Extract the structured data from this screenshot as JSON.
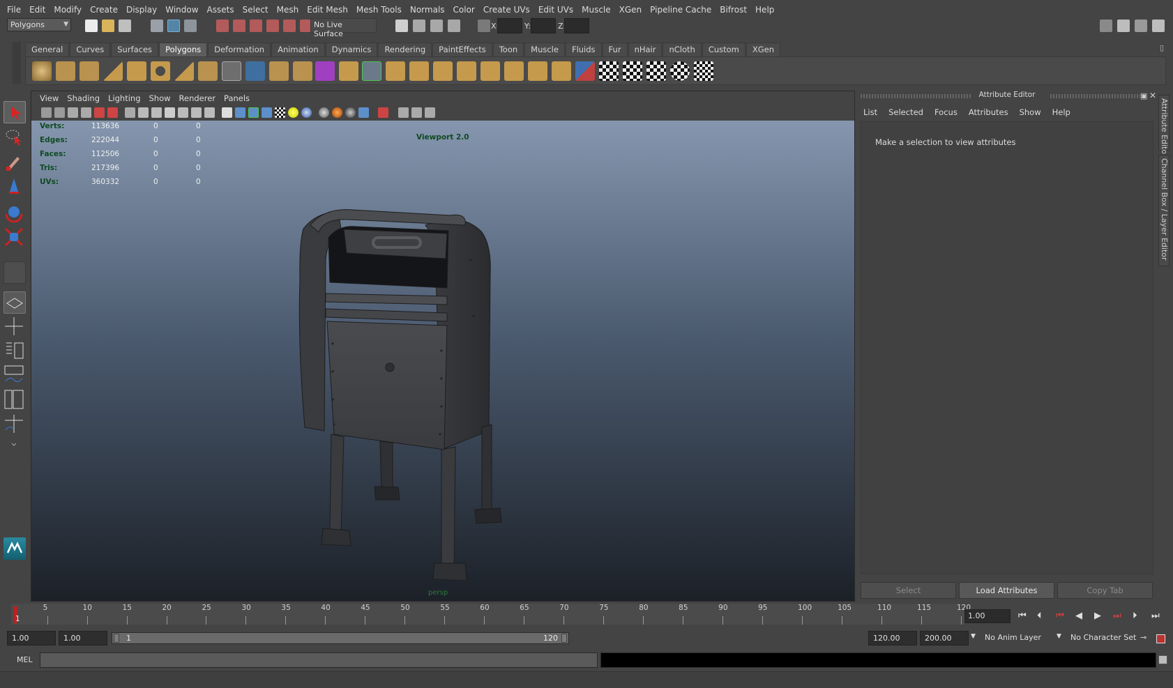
{
  "menubar": {
    "items": [
      "File",
      "Edit",
      "Modify",
      "Create",
      "Display",
      "Window",
      "Assets",
      "Select",
      "Mesh",
      "Edit Mesh",
      "Mesh Tools",
      "Normals",
      "Color",
      "Create UVs",
      "Edit UVs",
      "Muscle",
      "XGen",
      "Pipeline Cache",
      "Bifrost",
      "Help"
    ]
  },
  "statusline": {
    "menuset": "Polygons",
    "live_surface": "No Live Surface",
    "x_label": "X:",
    "y_label": "Y:",
    "z_label": "Z:"
  },
  "shelf": {
    "tabs": [
      "General",
      "Curves",
      "Surfaces",
      "Polygons",
      "Deformation",
      "Animation",
      "Dynamics",
      "Rendering",
      "PaintEffects",
      "Toon",
      "Muscle",
      "Fluids",
      "Fur",
      "nHair",
      "nCloth",
      "Custom",
      "XGen"
    ],
    "active_tab": "Polygons"
  },
  "viewport": {
    "menu": [
      "View",
      "Shading",
      "Lighting",
      "Show",
      "Renderer",
      "Panels"
    ],
    "renderer_label": "Viewport 2.0",
    "camera": "persp",
    "hud": [
      {
        "label": "Verts:",
        "total": "113636",
        "sel": "0",
        "comp": "0"
      },
      {
        "label": "Edges:",
        "total": "222044",
        "sel": "0",
        "comp": "0"
      },
      {
        "label": "Faces:",
        "total": "112506",
        "sel": "0",
        "comp": "0"
      },
      {
        "label": "Tris:",
        "total": "217396",
        "sel": "0",
        "comp": "0"
      },
      {
        "label": "UVs:",
        "total": "360332",
        "sel": "0",
        "comp": "0"
      }
    ]
  },
  "attribute_editor": {
    "title": "Attribute Editor",
    "menu": [
      "List",
      "Selected",
      "Focus",
      "Attributes",
      "Show",
      "Help"
    ],
    "message": "Make a selection to view attributes",
    "buttons": {
      "select": "Select",
      "load": "Load Attributes",
      "copy": "Copy Tab"
    },
    "side_tabs": [
      "Attribute Editor",
      "Channel Box / Layer Editor"
    ]
  },
  "timeslider": {
    "start_marker": "1",
    "labels": [
      "5",
      "10",
      "15",
      "20",
      "25",
      "30",
      "35",
      "40",
      "45",
      "50",
      "55",
      "60",
      "65",
      "70",
      "75",
      "80",
      "85",
      "90",
      "95",
      "100",
      "105",
      "110",
      "115",
      "120"
    ],
    "current_frame": "1.00"
  },
  "rangeslider": {
    "anim_start": "1.00",
    "playback_start": "1.00",
    "range_min_label": "1",
    "range_max_label": "120",
    "playback_end": "120.00",
    "anim_end": "200.00",
    "anim_layer": "No Anim Layer",
    "character_set": "No Character Set"
  },
  "cmdline": {
    "label": "MEL"
  },
  "colors": {
    "ui_bg": "#444444",
    "accent": "#5285a6",
    "hud_green": "#0f4a22"
  }
}
